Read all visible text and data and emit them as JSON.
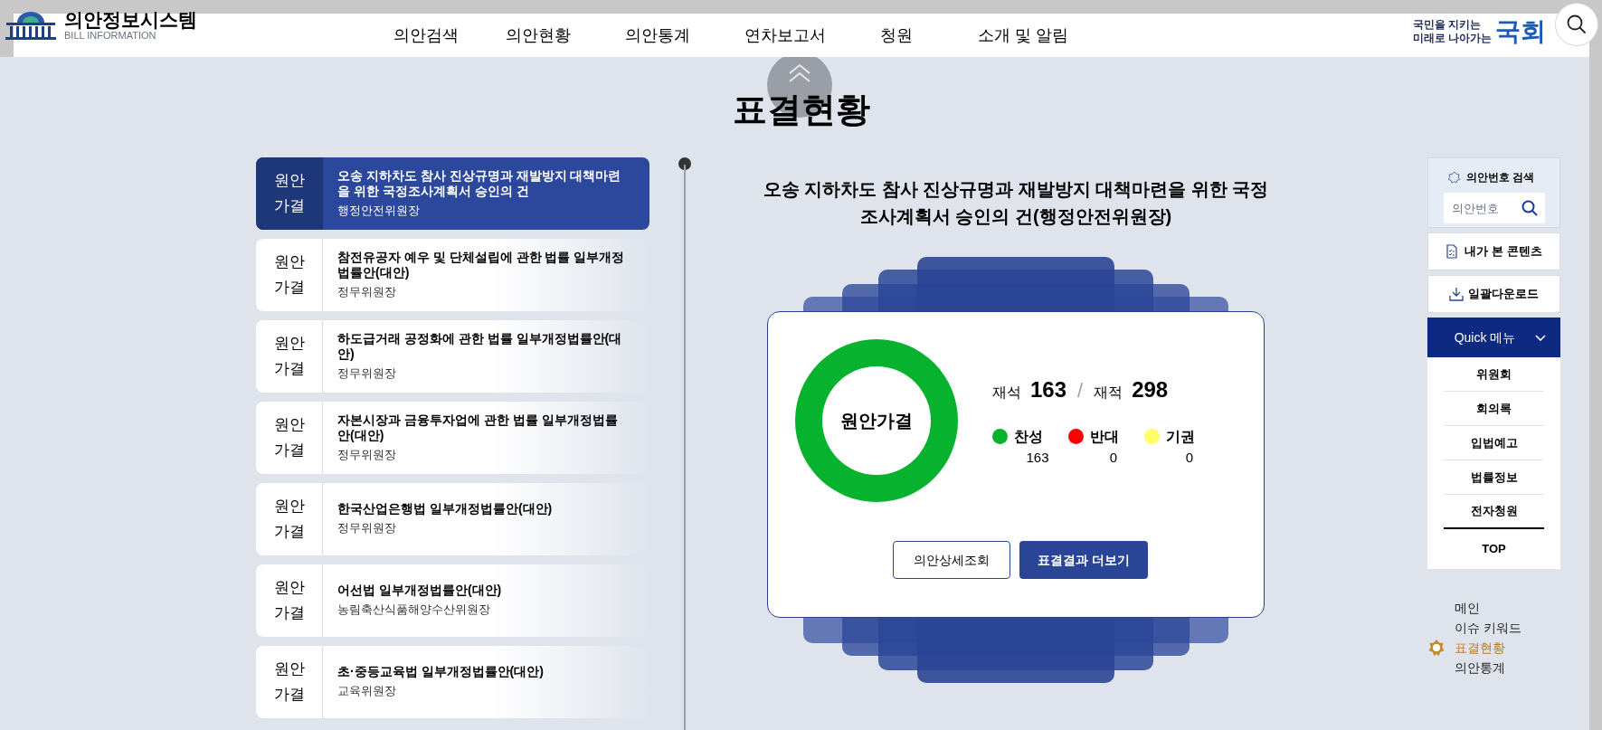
{
  "header": {
    "logo_title": "의안정보시스템",
    "logo_subtitle": "BILL INFORMATION",
    "nav": [
      {
        "label": "의안검색"
      },
      {
        "label": "의안현황"
      },
      {
        "label": "의안통계"
      },
      {
        "label": "연차보고서"
      },
      {
        "label": "청원"
      },
      {
        "label": "소개 및 알림"
      }
    ],
    "slogan": [
      "국민을 지키는",
      "미래로 나아가는"
    ],
    "emblem": "국회"
  },
  "page_title": "표결현황",
  "bills": [
    {
      "result": "원안 가결",
      "title": "오송 지하차도 참사 진상규명과 재발방지 대책마련을 위한 국정조사계획서 승인의 건",
      "committee": "행정안전위원장",
      "selected": true
    },
    {
      "result": "원안 가결",
      "title": "참전유공자 예우 및 단체설립에 관한 법률 일부개정법률안(대안)",
      "committee": "정무위원장",
      "selected": false
    },
    {
      "result": "원안 가결",
      "title": "하도급거래 공정화에 관한 법률 일부개정법률안(대안)",
      "committee": "정무위원장",
      "selected": false
    },
    {
      "result": "원안 가결",
      "title": "자본시장과 금융투자업에 관한 법률 일부개정법률안(대안)",
      "committee": "정무위원장",
      "selected": false
    },
    {
      "result": "원안 가결",
      "title": "한국산업은행법 일부개정법률안(대안)",
      "committee": "정무위원장",
      "selected": false
    },
    {
      "result": "원안 가결",
      "title": "어선법 일부개정법률안(대안)",
      "committee": "농림축산식품해양수산위원장",
      "selected": false
    },
    {
      "result": "원안 가결",
      "title": "초·중등교육법 일부개정법률안(대안)",
      "committee": "교육위원장",
      "selected": false
    }
  ],
  "detail": {
    "title": "오송 지하차도 참사 진상규명과 재발방지 대책마련을 위한 국정조사계획서 승인의 건(행정안전위원장)",
    "result": "원안가결",
    "stats": [
      {
        "label": "재석",
        "value": "163"
      },
      {
        "label": "재적",
        "value": "298"
      }
    ],
    "separator": "/",
    "votes": [
      {
        "label": "찬성",
        "value": "163",
        "color": "#07b22e"
      },
      {
        "label": "반대",
        "value": "0",
        "color": "#ff0000"
      },
      {
        "label": "기권",
        "value": "0",
        "color": "#ffff66"
      }
    ],
    "buttons": [
      {
        "label": "의안상세조회",
        "kind": "outline"
      },
      {
        "label": "표결결과 더보기",
        "kind": "filled"
      }
    ]
  },
  "sidebar": {
    "search": {
      "title": "의안번호 검색",
      "placeholder": "의안번호"
    },
    "buttons": [
      {
        "label": "내가 본 콘텐츠",
        "kind": "document"
      },
      {
        "label": "일괄다운로드",
        "kind": "download"
      }
    ],
    "quick_menu": {
      "title": "Quick 메뉴",
      "expanded": true,
      "items": [
        "위원회",
        "회의록",
        "입법예고",
        "법률정보",
        "전자청원"
      ]
    },
    "top": "TOP",
    "page_nav": [
      {
        "label": "메인",
        "selected": false
      },
      {
        "label": "이슈 키워드",
        "selected": false
      },
      {
        "label": "표결현황",
        "selected": true
      },
      {
        "label": "의안통계",
        "selected": false
      }
    ]
  }
}
